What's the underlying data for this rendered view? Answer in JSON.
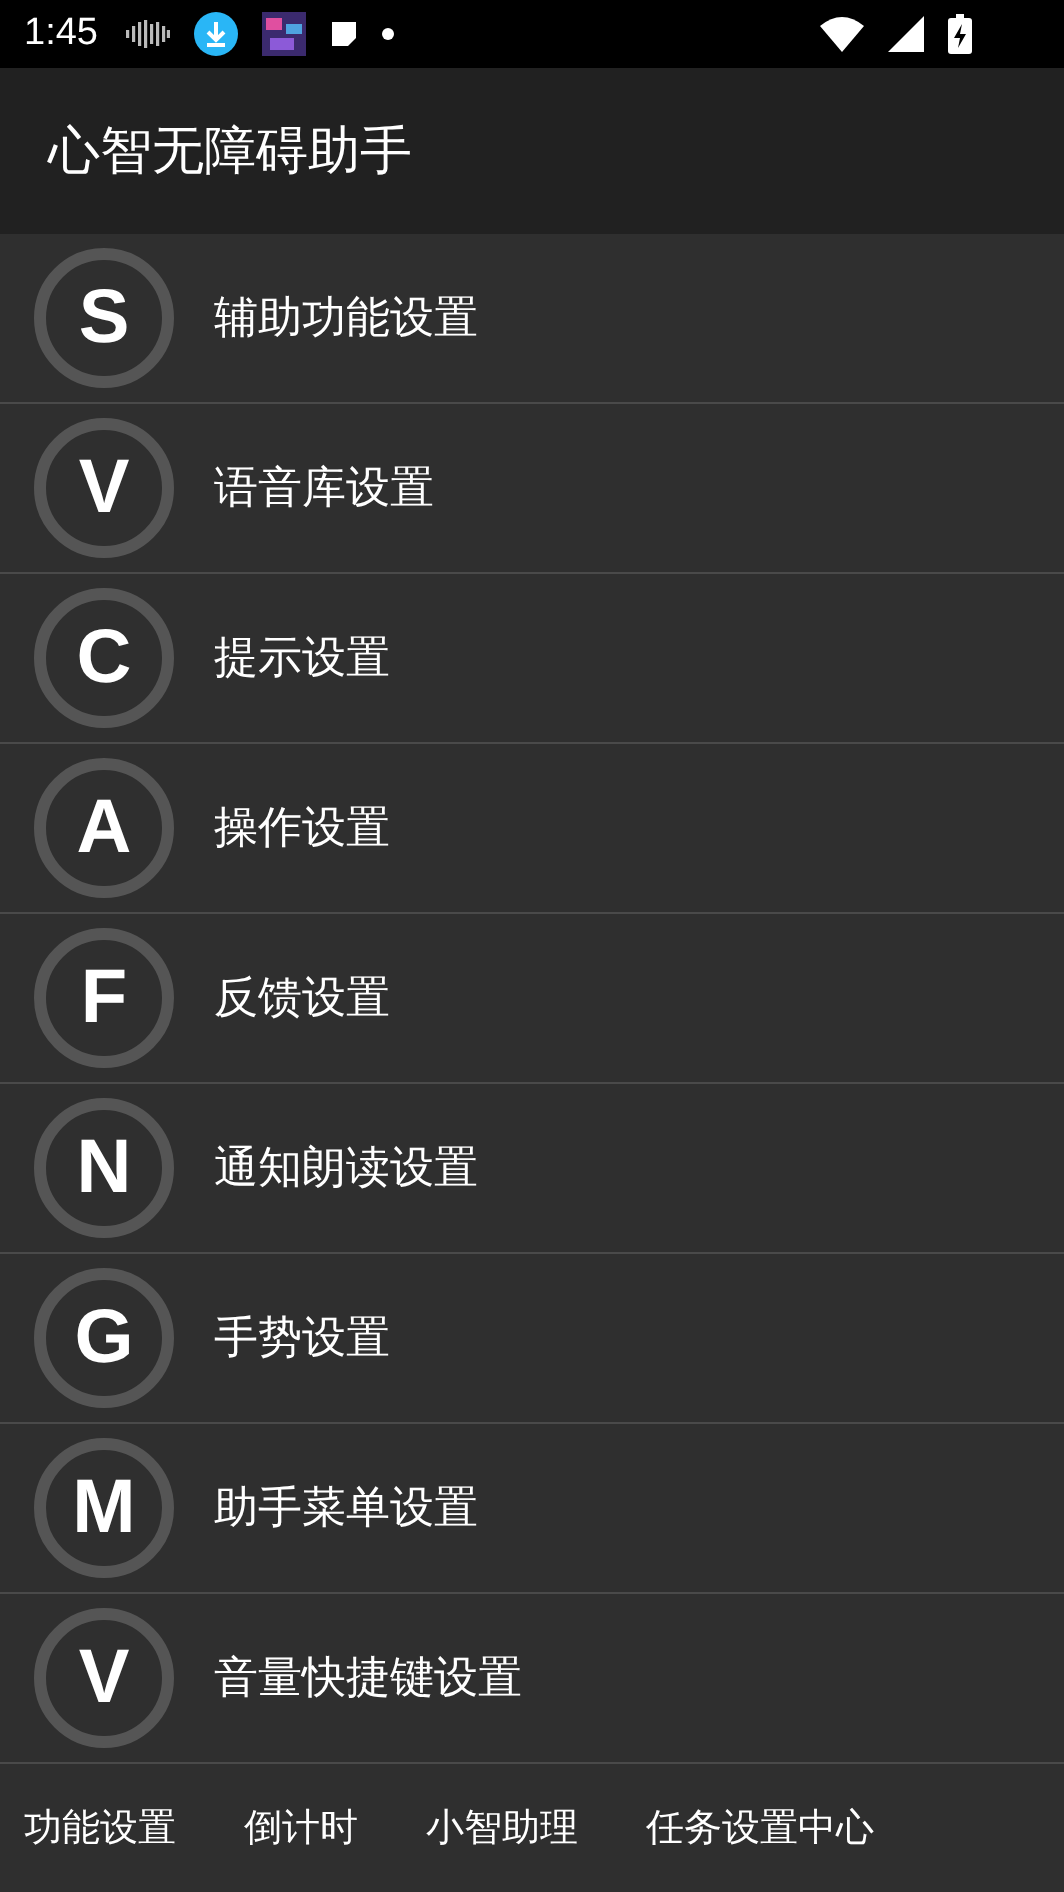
{
  "status_bar": {
    "time": "1:45"
  },
  "app_bar": {
    "title": "心智无障碍助手"
  },
  "items": [
    {
      "letter": "S",
      "label": "辅助功能设置"
    },
    {
      "letter": "V",
      "label": "语音库设置"
    },
    {
      "letter": "C",
      "label": "提示设置"
    },
    {
      "letter": "A",
      "label": "操作设置"
    },
    {
      "letter": "F",
      "label": "反馈设置"
    },
    {
      "letter": "N",
      "label": "通知朗读设置"
    },
    {
      "letter": "G",
      "label": "手势设置"
    },
    {
      "letter": "M",
      "label": "助手菜单设置"
    },
    {
      "letter": "V",
      "label": "音量快捷键设置"
    }
  ],
  "tabs": [
    {
      "label": "功能设置"
    },
    {
      "label": "倒计时"
    },
    {
      "label": "小智助理"
    },
    {
      "label": "任务设置中心"
    }
  ]
}
